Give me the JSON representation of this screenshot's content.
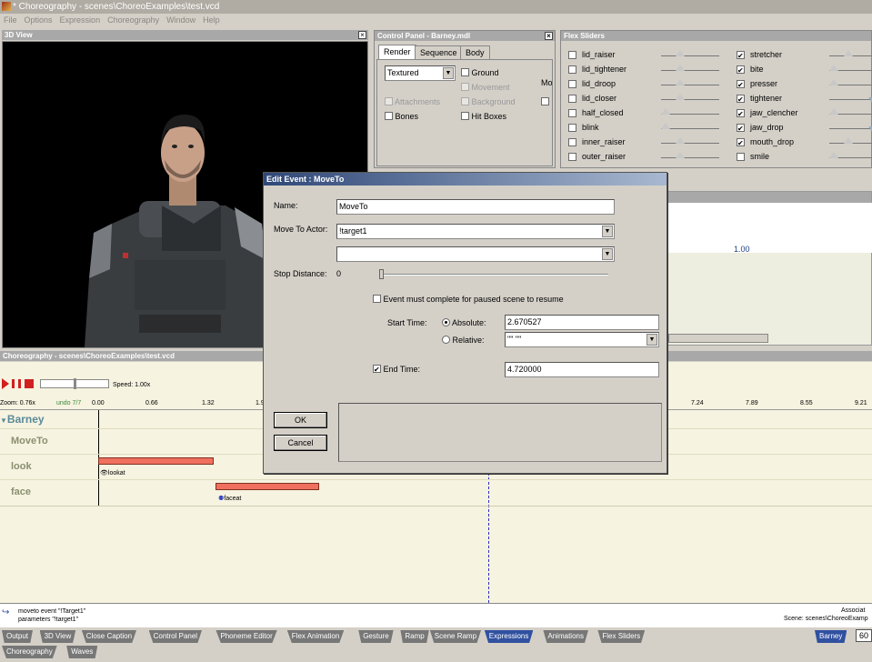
{
  "window": {
    "title": "* Choreography - scenes\\ChoreoExamples\\test.vcd"
  },
  "menu": [
    "File",
    "Options",
    "Expression",
    "Choreography",
    "Window",
    "Help"
  ],
  "view3d": {
    "title": "3D View"
  },
  "control_panel": {
    "title": "Control Panel - Barney.mdl",
    "tabs": [
      "Render",
      "Sequence",
      "Body"
    ],
    "render_mode": "Textured",
    "checks": {
      "ground": "Ground",
      "movement": "Movement",
      "mo": "Mo",
      "attachments": "Attachments",
      "background": "Background",
      "bones": "Bones",
      "hitboxes": "Hit Boxes"
    }
  },
  "flex_sliders": {
    "title": "Flex Sliders",
    "left": [
      "lid_raiser",
      "lid_tightener",
      "lid_droop",
      "lid_closer",
      "half_closed",
      "blink",
      "inner_raiser",
      "outer_raiser"
    ],
    "right": [
      "stretcher",
      "bite",
      "presser",
      "tightener",
      "jaw_clencher",
      "jaw_drop",
      "mouth_drop",
      "smile"
    ],
    "left_values": [
      0.3,
      0.3,
      0.3,
      0.3,
      0.0,
      0.0,
      0.3,
      0.3
    ],
    "right_values": [
      0.3,
      0.0,
      0.0,
      0.8,
      0.0,
      0.8,
      0.3,
      0.0
    ]
  },
  "dialog": {
    "title": "Edit Event : MoveTo",
    "name_label": "Name:",
    "name_value": "MoveTo",
    "actor_label": "Move To Actor:",
    "actor_value": "!target1",
    "stop_label": "Stop Distance:",
    "stop_value": "0",
    "complete_label": "Event must complete for paused scene to resume",
    "start_label": "Start Time:",
    "absolute_label": "Absolute:",
    "absolute_value": "2.670527",
    "relative_label": "Relative:",
    "relative_value": "\"\" \"\"",
    "endtime_label": "End Time:",
    "endtime_value": "4.720000",
    "ok": "OK",
    "cancel": "Cancel"
  },
  "right_panel": {
    "ruler_value": "1.00"
  },
  "choreo": {
    "title": "Choreography - scenes\\ChoreoExamples\\test.vcd",
    "speed": "Speed: 1.00x",
    "zoom": "Zoom: 0.76x",
    "undo": "undo 7/7",
    "ticks": [
      "0.00",
      "0.66",
      "1.32",
      "1.9"
    ],
    "ticks_right": [
      "7.24",
      "7.89",
      "8.55",
      "9.21"
    ],
    "actor": "Barney",
    "channels": [
      "MoveTo",
      "look",
      "face"
    ],
    "events": {
      "lookat": "lookat",
      "faceat": "faceat"
    }
  },
  "status": {
    "line1": "moveto event \"!Target1\"",
    "line2": "parameters \"!target1\"",
    "right1": "Associat",
    "right2": "Scene:  scenes\\ChoreoExamp",
    "fps": "60"
  },
  "tabs_bottom": [
    "Output",
    "3D View",
    "Close Caption",
    "Control Panel",
    "Phoneme Editor",
    "Flex Animation",
    "Gesture",
    "Ramp",
    "Scene Ramp",
    "Expressions",
    "Animations",
    "Flex Sliders"
  ],
  "tabs_bottom2": [
    "Choreography",
    "Waves"
  ],
  "actor_tab": "Barney"
}
